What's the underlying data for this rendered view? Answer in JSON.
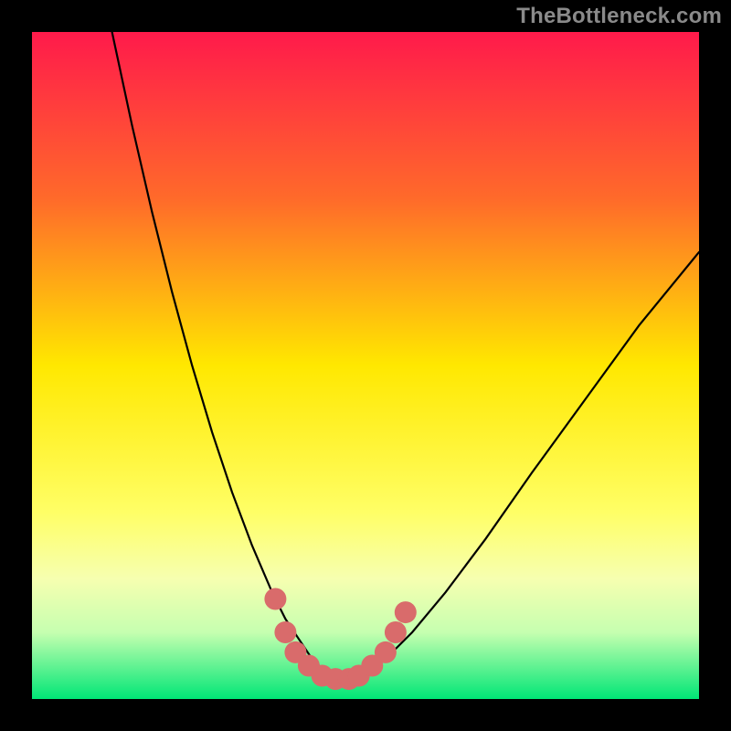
{
  "watermark": "TheBottleneck.com",
  "chart_data": {
    "type": "line",
    "title": "",
    "xlabel": "",
    "ylabel": "",
    "xlim": [
      0,
      100
    ],
    "ylim": [
      0,
      100
    ],
    "gradient_stops": [
      {
        "offset": 0,
        "color": "#ff1a4b"
      },
      {
        "offset": 25,
        "color": "#ff6a2a"
      },
      {
        "offset": 50,
        "color": "#ffe800"
      },
      {
        "offset": 72,
        "color": "#ffff66"
      },
      {
        "offset": 82,
        "color": "#f6ffb0"
      },
      {
        "offset": 90,
        "color": "#c6ffb0"
      },
      {
        "offset": 100,
        "color": "#00e676"
      }
    ],
    "series": [
      {
        "name": "bottleneck-curve",
        "x": [
          12,
          15,
          18,
          21,
          24,
          27,
          30,
          33,
          36,
          38,
          40,
          42,
          44,
          46,
          48,
          50,
          53,
          57,
          62,
          68,
          75,
          83,
          91,
          100
        ],
        "y": [
          100,
          86,
          73,
          61,
          50,
          40,
          31,
          23,
          16,
          12,
          9,
          6,
          4,
          3,
          3,
          4,
          6,
          10,
          16,
          24,
          34,
          45,
          56,
          67
        ]
      }
    ],
    "markers": {
      "name": "highlight-dots",
      "color": "#d96b6b",
      "points": [
        {
          "x": 36.5,
          "y": 15
        },
        {
          "x": 38,
          "y": 10
        },
        {
          "x": 39.5,
          "y": 7
        },
        {
          "x": 41.5,
          "y": 5
        },
        {
          "x": 43.5,
          "y": 3.5
        },
        {
          "x": 45.5,
          "y": 3
        },
        {
          "x": 47.5,
          "y": 3
        },
        {
          "x": 49,
          "y": 3.5
        },
        {
          "x": 51,
          "y": 5
        },
        {
          "x": 53,
          "y": 7
        },
        {
          "x": 54.5,
          "y": 10
        },
        {
          "x": 56,
          "y": 13
        }
      ]
    }
  }
}
